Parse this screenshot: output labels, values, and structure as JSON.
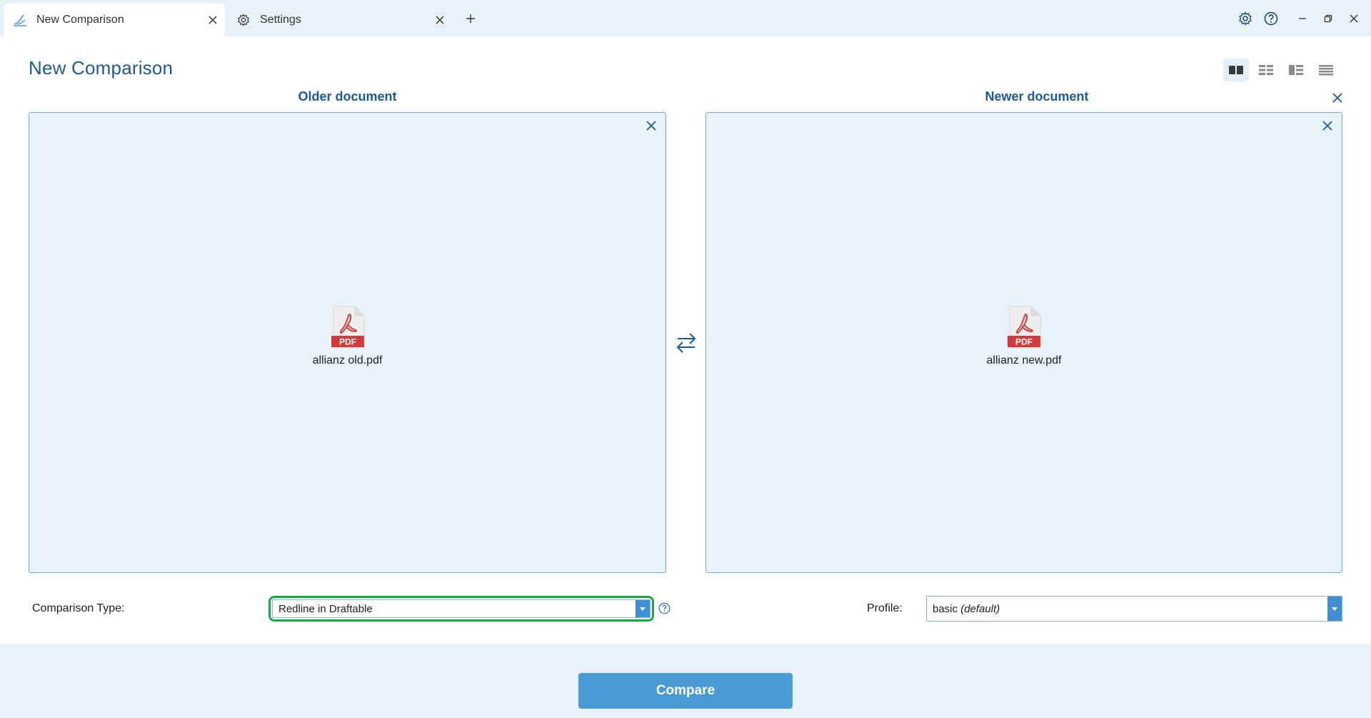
{
  "tabs": [
    {
      "label": "New Comparison",
      "icon": "draftable-logo-icon",
      "active": true
    },
    {
      "label": "Settings",
      "icon": "gear-icon",
      "active": false
    }
  ],
  "page": {
    "title": "New Comparison"
  },
  "older": {
    "heading": "Older document",
    "file_name": "allianz old.pdf",
    "file_badge": "PDF"
  },
  "newer": {
    "heading": "Newer document",
    "file_name": "allianz new.pdf",
    "file_badge": "PDF"
  },
  "options": {
    "comparison_type_label": "Comparison Type:",
    "comparison_type_value": "Redline in Draftable",
    "profile_label": "Profile:",
    "profile_value_main": "basic",
    "profile_value_suffix": "(default)"
  },
  "actions": {
    "compare_label": "Compare"
  },
  "colors": {
    "accent": "#1d5a93",
    "panel_bg": "#e8f2fa",
    "focus_ring": "#1da54a",
    "button": "#4a9ad6",
    "pdf_red": "#d23b3b"
  }
}
